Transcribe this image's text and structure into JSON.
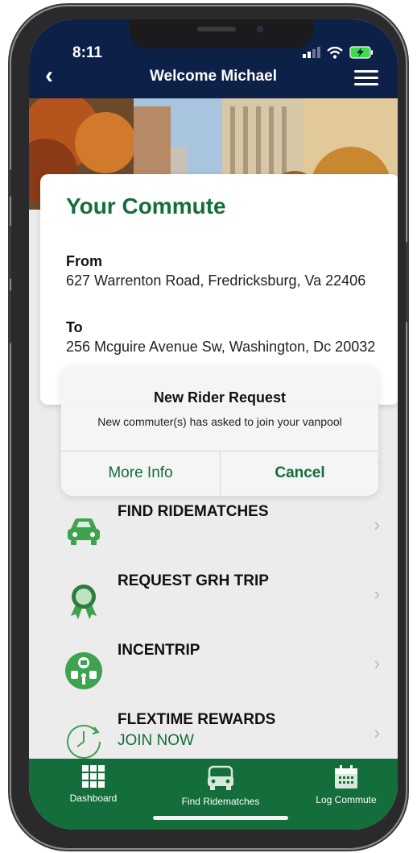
{
  "status_bar": {
    "time": "8:11"
  },
  "header": {
    "title": "Welcome Michael",
    "back_icon": "chevron-left-icon",
    "menu_icon": "hamburger-menu-icon"
  },
  "commute": {
    "title": "Your Commute",
    "from_label": "From",
    "from_value": "627 Warrenton Road, Fredricksburg, Va 22406",
    "to_label": "To",
    "to_value": "256 Mcguire Avenue Sw, Washington, Dc 20032"
  },
  "alert": {
    "title": "New Rider Request",
    "message": "New commuter(s) has asked to join your vanpool",
    "more_info": "More Info",
    "cancel": "Cancel"
  },
  "menu": {
    "items": [
      {
        "label": "FIND RIDEMATCHES",
        "icon": "car-icon"
      },
      {
        "label": "REQUEST GRH TRIP",
        "icon": "award-badge-icon"
      },
      {
        "label": "INCENTRIP",
        "icon": "transit-modes-icon"
      },
      {
        "label": "FLEXTIME REWARDS",
        "sub": "JOIN NOW",
        "icon": "clock-icon"
      }
    ]
  },
  "tabs": [
    {
      "label": "Dashboard",
      "icon": "grid-icon"
    },
    {
      "label": "Find Ridematches",
      "icon": "car-icon"
    },
    {
      "label": "Log Commute",
      "icon": "calendar-icon"
    }
  ],
  "colors": {
    "header_bg": "#0d2048",
    "brand_green": "#136e3c",
    "screen_bg": "#ececec"
  }
}
